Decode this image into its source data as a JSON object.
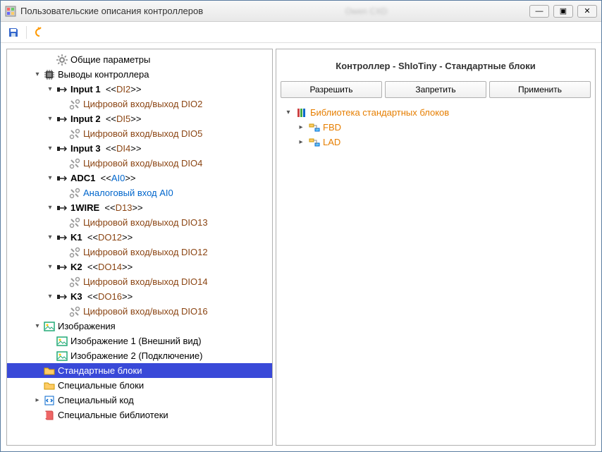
{
  "window": {
    "title": "Пользовательские описания контроллеров",
    "blur_text": "Owen CXD"
  },
  "winbtns": {
    "min": "—",
    "max": "▣",
    "close": "✕"
  },
  "tree": [
    {
      "indent": 3,
      "chev": "none",
      "icon": "gear",
      "parts": [
        {
          "t": "Общие параметры"
        }
      ]
    },
    {
      "indent": 2,
      "chev": "down",
      "icon": "chip",
      "parts": [
        {
          "t": "Выводы контроллера"
        }
      ]
    },
    {
      "indent": 3,
      "chev": "down",
      "icon": "io",
      "parts": [
        {
          "t": "Input 1",
          "cls": "bold"
        },
        {
          "t": "  <<"
        },
        {
          "t": "DI2",
          "cls": "brown"
        },
        {
          "t": ">>"
        }
      ]
    },
    {
      "indent": 4,
      "chev": "none",
      "icon": "tool",
      "parts": [
        {
          "t": "Цифровой вход/выход DIO2",
          "cls": "brown"
        }
      ]
    },
    {
      "indent": 3,
      "chev": "down",
      "icon": "io",
      "parts": [
        {
          "t": "Input 2",
          "cls": "bold"
        },
        {
          "t": "  <<"
        },
        {
          "t": "DI5",
          "cls": "brown"
        },
        {
          "t": ">>"
        }
      ]
    },
    {
      "indent": 4,
      "chev": "none",
      "icon": "tool",
      "parts": [
        {
          "t": "Цифровой вход/выход DIO5",
          "cls": "brown"
        }
      ]
    },
    {
      "indent": 3,
      "chev": "down",
      "icon": "io",
      "parts": [
        {
          "t": "Input 3",
          "cls": "bold"
        },
        {
          "t": "  <<"
        },
        {
          "t": "DI4",
          "cls": "brown"
        },
        {
          "t": ">>"
        }
      ]
    },
    {
      "indent": 4,
      "chev": "none",
      "icon": "tool",
      "parts": [
        {
          "t": "Цифровой вход/выход DIO4",
          "cls": "brown"
        }
      ]
    },
    {
      "indent": 3,
      "chev": "down",
      "icon": "io",
      "parts": [
        {
          "t": "ADC1",
          "cls": "bold"
        },
        {
          "t": "  <<"
        },
        {
          "t": "AI0",
          "cls": "blue"
        },
        {
          "t": ">>"
        }
      ]
    },
    {
      "indent": 4,
      "chev": "none",
      "icon": "tool",
      "parts": [
        {
          "t": "Аналоговый вход AI0",
          "cls": "blue"
        }
      ]
    },
    {
      "indent": 3,
      "chev": "down",
      "icon": "io",
      "parts": [
        {
          "t": "1WIRE",
          "cls": "bold"
        },
        {
          "t": "  <<"
        },
        {
          "t": "D13",
          "cls": "brown"
        },
        {
          "t": ">>"
        }
      ]
    },
    {
      "indent": 4,
      "chev": "none",
      "icon": "tool",
      "parts": [
        {
          "t": "Цифровой вход/выход DIO13",
          "cls": "brown"
        }
      ]
    },
    {
      "indent": 3,
      "chev": "down",
      "icon": "io",
      "parts": [
        {
          "t": "K1",
          "cls": "bold"
        },
        {
          "t": "  <<"
        },
        {
          "t": "DO12",
          "cls": "brown"
        },
        {
          "t": ">>"
        }
      ]
    },
    {
      "indent": 4,
      "chev": "none",
      "icon": "tool",
      "parts": [
        {
          "t": "Цифровой вход/выход DIO12",
          "cls": "brown"
        }
      ]
    },
    {
      "indent": 3,
      "chev": "down",
      "icon": "io",
      "parts": [
        {
          "t": "K2",
          "cls": "bold"
        },
        {
          "t": "  <<"
        },
        {
          "t": "DO14",
          "cls": "brown"
        },
        {
          "t": ">>"
        }
      ]
    },
    {
      "indent": 4,
      "chev": "none",
      "icon": "tool",
      "parts": [
        {
          "t": "Цифровой вход/выход DIO14",
          "cls": "brown"
        }
      ]
    },
    {
      "indent": 3,
      "chev": "down",
      "icon": "io",
      "parts": [
        {
          "t": "K3",
          "cls": "bold"
        },
        {
          "t": "  <<"
        },
        {
          "t": "DO16",
          "cls": "brown"
        },
        {
          "t": ">>"
        }
      ]
    },
    {
      "indent": 4,
      "chev": "none",
      "icon": "tool",
      "parts": [
        {
          "t": "Цифровой вход/выход DIO16",
          "cls": "brown"
        }
      ]
    },
    {
      "indent": 2,
      "chev": "down",
      "icon": "img",
      "parts": [
        {
          "t": "Изображения"
        }
      ]
    },
    {
      "indent": 3,
      "chev": "none",
      "icon": "img",
      "parts": [
        {
          "t": "Изображение 1 (Внешний вид)"
        }
      ]
    },
    {
      "indent": 3,
      "chev": "none",
      "icon": "img",
      "parts": [
        {
          "t": "Изображение 2 (Подключение)"
        }
      ]
    },
    {
      "indent": 2,
      "chev": "none",
      "icon": "folder",
      "parts": [
        {
          "t": "Стандартные блоки"
        }
      ],
      "selected": true
    },
    {
      "indent": 2,
      "chev": "none",
      "icon": "folder",
      "parts": [
        {
          "t": "Специальные блоки"
        }
      ]
    },
    {
      "indent": 2,
      "chev": "right",
      "icon": "code",
      "parts": [
        {
          "t": "Специальный код"
        }
      ]
    },
    {
      "indent": 2,
      "chev": "none",
      "icon": "book",
      "parts": [
        {
          "t": "Специальные библиотеки"
        }
      ]
    }
  ],
  "right": {
    "title": "Контроллер - ShIoTiny - Стандартные блоки",
    "buttons": {
      "allow": "Разрешить",
      "deny": "Запретить",
      "apply": "Применить"
    },
    "tree": [
      {
        "indent": 0,
        "chev": "down",
        "icon": "lib",
        "text": "Библиотека стандартных блоков",
        "cls": "orange"
      },
      {
        "indent": 1,
        "chev": "right",
        "icon": "fbd",
        "text": "FBD",
        "cls": "orange"
      },
      {
        "indent": 1,
        "chev": "right",
        "icon": "fbd",
        "text": "LAD",
        "cls": "orange"
      }
    ]
  }
}
